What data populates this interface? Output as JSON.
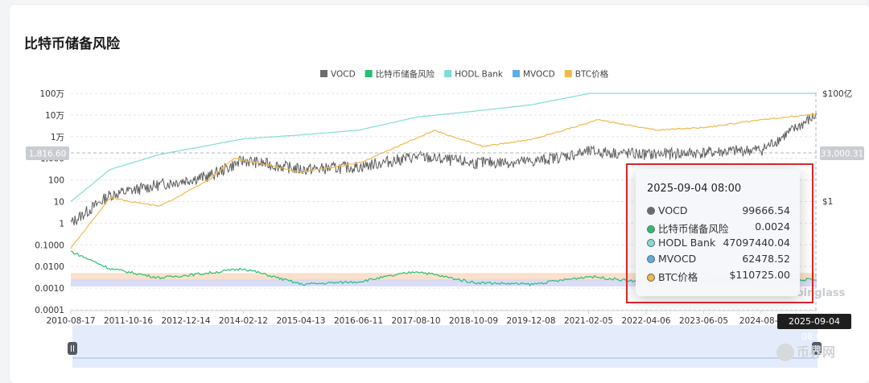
{
  "page": {
    "title": "比特币储备风险"
  },
  "chart_data": {
    "type": "line",
    "title": "比特币储备风险",
    "x_ticks": [
      "2010-08-17",
      "2011-10-16",
      "2012-12-14",
      "2014-02-12",
      "2015-04-13",
      "2016-06-11",
      "2017-08-10",
      "2018-10-09",
      "2019-12-08",
      "2021-02-05",
      "2022-04-06",
      "2023-06-05",
      "2024-08-0"
    ],
    "x_range": [
      "2010-08-17",
      "2025-09-04"
    ],
    "y_left_scale": "log",
    "y_left_ticks": [
      "100万",
      "10万",
      "1万",
      "1,000",
      "100",
      "10",
      "1",
      "0.1000",
      "0.0100",
      "0.0010",
      "0.0001"
    ],
    "y_left_range": [
      0.0001,
      1000000
    ],
    "y_right_ticks": [
      "$100亿",
      "$1"
    ],
    "crosshair_left_label": "1,816.60",
    "crosshair_right_label": "33,000.31",
    "legend_position": "top",
    "grid": "horizontal-dashed",
    "risk_bands": [
      {
        "from": 0.002,
        "to": 0.005,
        "color": "#f9dcc4"
      },
      {
        "from": 0.0012,
        "to": 0.0025,
        "color": "#d3d7f7"
      }
    ],
    "series": [
      {
        "name": "VOCD",
        "color": "#5d5d5d",
        "x": [
          "2010-08-17",
          "2011-06-01",
          "2012-06-01",
          "2013-06-01",
          "2014-02-12",
          "2015-04-13",
          "2016-06-11",
          "2017-08-10",
          "2018-10-09",
          "2019-12-08",
          "2021-02-05",
          "2022-04-06",
          "2023-06-05",
          "2024-08-01",
          "2025-09-04"
        ],
        "values": [
          1,
          20,
          60,
          150,
          800,
          300,
          400,
          1200,
          600,
          700,
          2000,
          1500,
          1800,
          2500,
          99666.54
        ]
      },
      {
        "name": "比特币储备风险",
        "color": "#27c072",
        "x": [
          "2010-08-17",
          "2011-06-01",
          "2012-06-01",
          "2013-06-01",
          "2014-02-12",
          "2015-04-13",
          "2016-06-11",
          "2017-08-10",
          "2018-10-09",
          "2019-12-08",
          "2021-02-05",
          "2022-04-06",
          "2023-06-05",
          "2024-08-01",
          "2025-09-04"
        ],
        "values": [
          0.05,
          0.008,
          0.003,
          0.005,
          0.008,
          0.0015,
          0.002,
          0.006,
          0.0018,
          0.0015,
          0.0035,
          0.0018,
          0.0022,
          0.0028,
          0.0024
        ]
      },
      {
        "name": "HODL Bank",
        "color": "#7fdcd7",
        "x": [
          "2010-08-17",
          "2011-06-01",
          "2012-06-01",
          "2013-06-01",
          "2014-02-12",
          "2015-04-13",
          "2016-06-11",
          "2017-08-10",
          "2018-10-09",
          "2019-12-08",
          "2021-02-05",
          "2022-04-06",
          "2023-06-05",
          "2024-08-01",
          "2025-09-04"
        ],
        "values": [
          10,
          300,
          1500,
          4000,
          8000,
          12000,
          20000,
          80000,
          150000,
          300000,
          1000000,
          2500000,
          4000000,
          8000000,
          47097440.04
        ]
      },
      {
        "name": "MVOCD",
        "color": "#5aaee6",
        "x": [
          "2025-09-04"
        ],
        "values": [
          62478.52
        ]
      },
      {
        "name": "BTC价格",
        "color": "#f2b84a",
        "x": [
          "2010-08-17",
          "2011-06-01",
          "2012-06-01",
          "2013-06-01",
          "2013-12-01",
          "2015-04-13",
          "2016-06-11",
          "2017-12-15",
          "2018-12-15",
          "2019-12-08",
          "2021-04-10",
          "2022-06-15",
          "2023-06-05",
          "2024-08-01",
          "2025-09-04"
        ],
        "values": [
          0.07,
          15,
          6,
          100,
          1000,
          230,
          600,
          19000,
          3500,
          7500,
          60000,
          20000,
          27000,
          60000,
          110725.0
        ]
      }
    ]
  },
  "legend": [
    {
      "label": "VOCD",
      "color": "#6b6b6b"
    },
    {
      "label": "比特币储备风险",
      "color": "#27c072"
    },
    {
      "label": "HODL Bank",
      "color": "#7fdcd7"
    },
    {
      "label": "MVOCD",
      "color": "#5aaee6"
    },
    {
      "label": "BTC价格",
      "color": "#f2b84a"
    }
  ],
  "tooltip": {
    "time": "2025-09-04 08:00",
    "rows": [
      {
        "name": "VOCD",
        "value": "99666.54",
        "color": "#6b6b6b"
      },
      {
        "name": "比特币储备风险",
        "value": "0.0024",
        "color": "#27c072"
      },
      {
        "name": "HODL Bank",
        "value": "47097440.04",
        "color": "#7fdcd7"
      },
      {
        "name": "MVOCD",
        "value": "62478.52",
        "color": "#5aaee6"
      },
      {
        "name": "BTC价格",
        "value": "$110725.00",
        "color": "#f2b84a"
      }
    ]
  },
  "crosshair_time": "2025-09-04 08:00",
  "watermarks": {
    "chart": "coinglass",
    "site": "币界网"
  }
}
